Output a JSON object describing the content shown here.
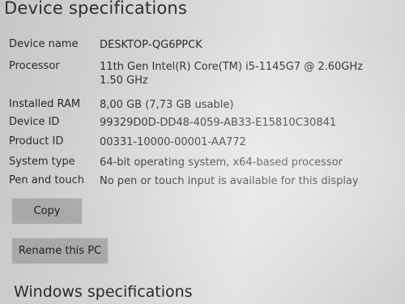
{
  "section_title": "Device specifications",
  "specs": [
    {
      "label": "Device name",
      "value": "DESKTOP-QG6PPCK"
    },
    {
      "label": "Processor",
      "value": "11th Gen Intel(R) Core(TM) i5-1145G7 @ 2.60GHz   1.50 GHz"
    },
    {
      "label": "Installed RAM",
      "value": "8,00 GB (7,73 GB usable)"
    },
    {
      "label": "Device ID",
      "value": "99329D0D-DD48-4059-AB33-E15810C30841"
    },
    {
      "label": "Product ID",
      "value": "00331-10000-00001-AA772"
    },
    {
      "label": "System type",
      "value": "64-bit operating system, x64-based processor"
    },
    {
      "label": "Pen and touch",
      "value": "No pen or touch input is available for this display"
    }
  ],
  "buttons": {
    "copy": "Copy",
    "rename": "Rename this PC"
  },
  "next_section_title": "Windows specifications"
}
